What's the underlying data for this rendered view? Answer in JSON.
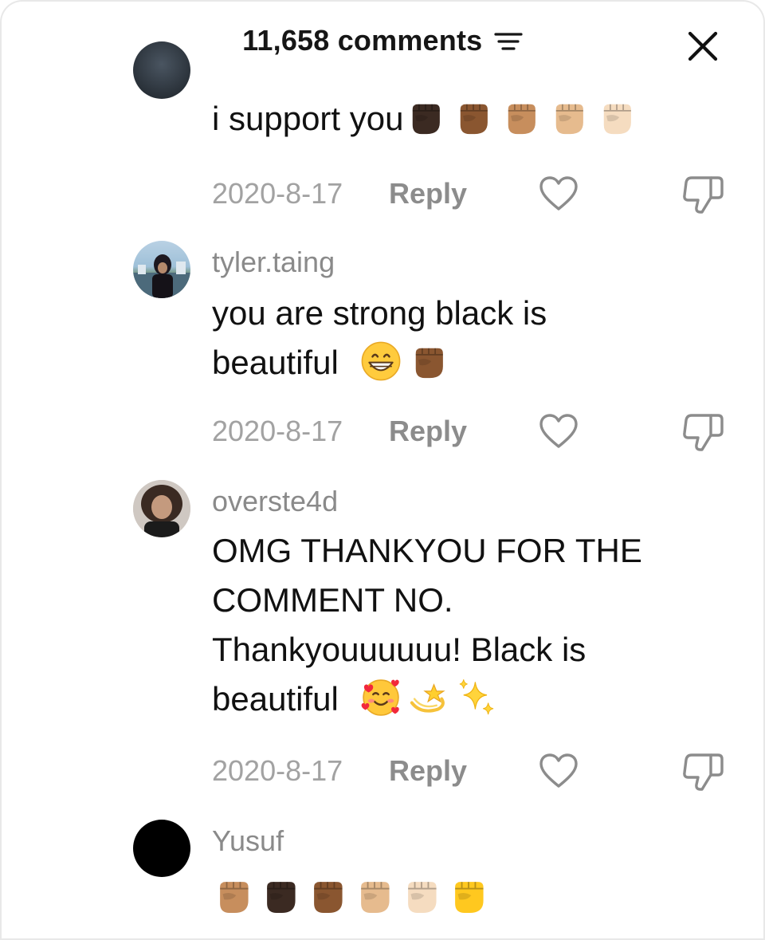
{
  "header": {
    "comment_count": "11,658 comments"
  },
  "comments": [
    {
      "username": "",
      "text": "i support you",
      "emojis": [
        "raised-fist-dark-skin",
        "raised-fist-medium-dark-skin",
        "raised-fist-medium-skin",
        "raised-fist-medium-light-skin",
        "raised-fist-light-skin"
      ],
      "date": "2020-8-17",
      "reply_label": "Reply"
    },
    {
      "username": "tyler.taing",
      "text_line1": "you are strong black is",
      "text_line2": "beautiful",
      "emojis": [
        "grinning-face",
        "raised-fist-medium-dark-skin"
      ],
      "date": "2020-8-17",
      "reply_label": "Reply"
    },
    {
      "username": "overste4d",
      "text_line1": "OMG THANKYOU FOR THE",
      "text_line2": "COMMENT NO.",
      "text_line3": "Thankyouuuuuu! Black is",
      "text_line4": "beautiful",
      "emojis": [
        "smiling-face-with-hearts",
        "dizzy",
        "sparkles"
      ],
      "date": "2020-8-17",
      "reply_label": "Reply"
    },
    {
      "username": "Yusuf",
      "emojis": [
        "raised-fist-medium-skin",
        "raised-fist-dark-skin",
        "raised-fist-medium-dark-skin",
        "raised-fist-medium-light-skin",
        "raised-fist-light-skin",
        "raised-fist-yellow"
      ]
    }
  ],
  "colors": {
    "username": "#8a8a8a",
    "date": "#a2a2a2",
    "reply": "#8c8c8c",
    "text": "#111111"
  }
}
